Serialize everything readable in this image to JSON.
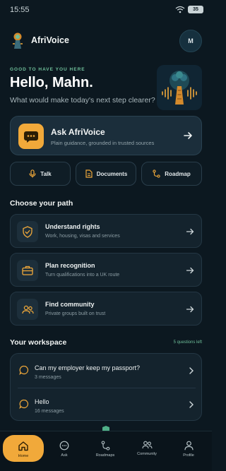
{
  "status_bar": {
    "time": "15:55",
    "battery": "35"
  },
  "header": {
    "app_name": "AfriVoice",
    "avatar_initial": "M"
  },
  "greeting": {
    "overline": "GOOD TO HAVE YOU HERE",
    "title": "Hello, Mahn.",
    "subtitle": "What would make today's next step clearer?"
  },
  "ask_card": {
    "title": "Ask AfriVoice",
    "subtitle": "Plain guidance, grounded in trusted sources"
  },
  "quick_actions": [
    {
      "label": "Talk",
      "icon": "microphone-icon"
    },
    {
      "label": "Documents",
      "icon": "documents-icon"
    },
    {
      "label": "Roadmap",
      "icon": "roadmap-icon"
    }
  ],
  "path_section": {
    "title": "Choose your path",
    "items": [
      {
        "title": "Understand rights",
        "subtitle": "Work, housing, visas and services",
        "icon": "shield-check-icon"
      },
      {
        "title": "Plan recognition",
        "subtitle": "Turn qualifications into a UK route",
        "icon": "briefcase-icon"
      },
      {
        "title": "Find community",
        "subtitle": "Private groups built on trust",
        "icon": "people-icon"
      }
    ]
  },
  "workspace": {
    "title": "Your workspace",
    "quota": "5 questions left",
    "items": [
      {
        "title": "Can my employer keep my passport?",
        "meta": "3 messages"
      },
      {
        "title": "Hello",
        "meta": "16 messages"
      }
    ]
  },
  "nav": {
    "items": [
      {
        "label": "Home",
        "icon": "home-icon"
      },
      {
        "label": "Ask",
        "icon": "chat-icon"
      },
      {
        "label": "Roadmaps",
        "icon": "roadmap-icon"
      },
      {
        "label": "Community",
        "icon": "people-icon"
      },
      {
        "label": "Profile",
        "icon": "person-icon"
      }
    ]
  },
  "colors": {
    "background": "#0c1820",
    "accent": "#f1a93a",
    "positive": "#6fbf9a"
  }
}
